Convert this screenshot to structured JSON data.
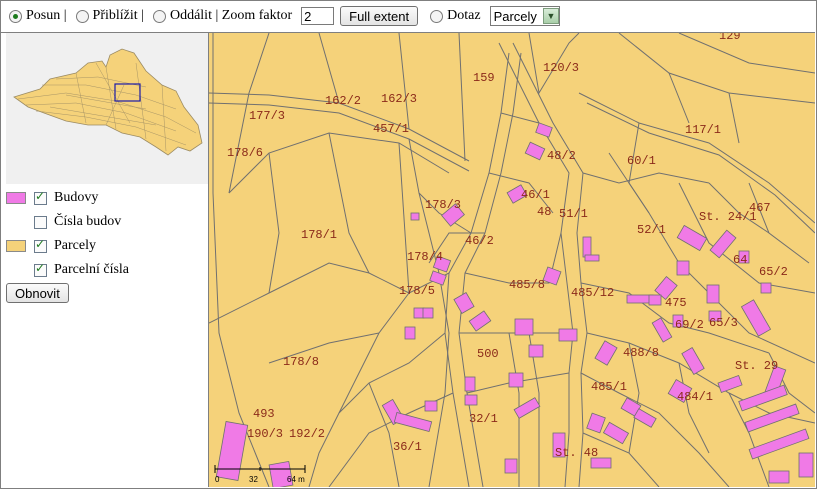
{
  "toolbar": {
    "pan_label": "Posun |",
    "zoom_in_label": "Přiblížit |",
    "zoom_out_label": "Oddálit | Zoom faktor",
    "zoom_factor_value": "2",
    "full_extent_label": "Full extent",
    "query_label": "Dotaz",
    "query_layer_selected": "Parcely"
  },
  "legend": {
    "items": [
      {
        "label": "Budovy",
        "checked": true
      },
      {
        "label": "Čísla budov",
        "checked": false
      },
      {
        "label": "Parcely",
        "checked": true
      },
      {
        "label": "Parcelní čísla",
        "checked": true
      }
    ],
    "refresh_label": "Obnovit"
  },
  "map": {
    "colors": {
      "parcel": "#f5d27a",
      "building": "#f07ae6",
      "line": "#707070",
      "label": "#8b2a1a"
    },
    "parcel_labels": [
      "129",
      "159",
      "120/3",
      "162/2",
      "162/3",
      "177/3",
      "457/1",
      "117/1",
      "178/6",
      "48/2",
      "60/1",
      "46/1",
      "48",
      "51/1",
      "178/3",
      "467",
      "St. 24/1",
      "178/1",
      "52/1",
      "46/2",
      "178/4",
      "64",
      "65/2",
      "485/8",
      "485/12",
      "178/5",
      "475",
      "69/2",
      "65/3",
      "500",
      "488/8",
      "178/8",
      "St. 29",
      "485/1",
      "484/1",
      "493",
      "190/3",
      "192/2",
      "32/1",
      "36/1",
      "St. 48"
    ],
    "scale_ticks": [
      "0",
      "32",
      "64 m"
    ]
  }
}
